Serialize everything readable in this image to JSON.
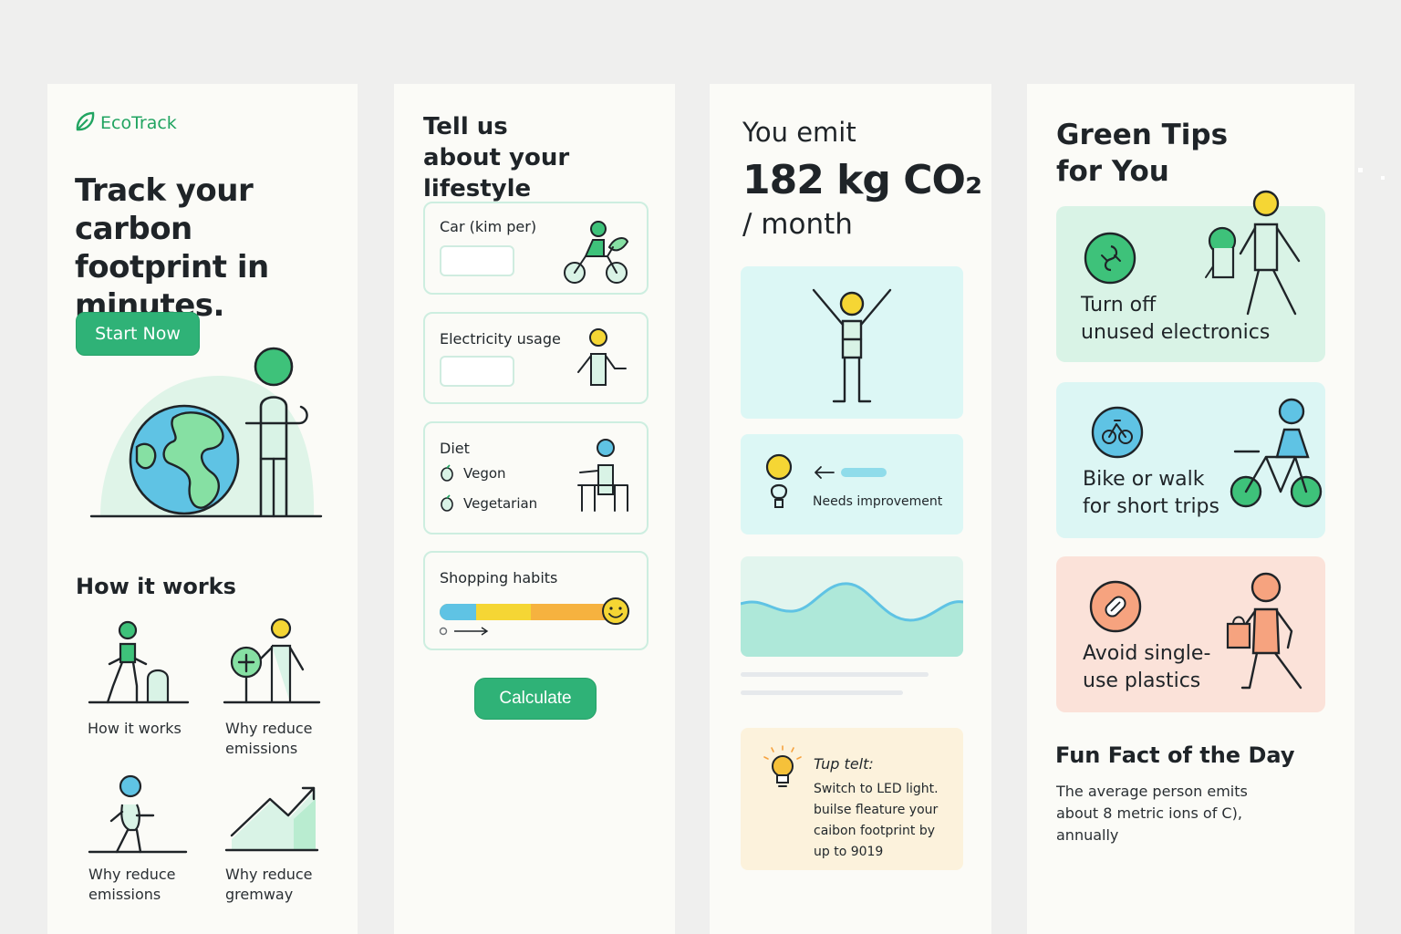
{
  "brand": {
    "name": "EcoTrack"
  },
  "landing": {
    "headline": "Track your carbon footprint in minutes.",
    "cta_label": "Start Now",
    "how_heading": "How it works",
    "steps": [
      {
        "label": "How it works"
      },
      {
        "label": "Why reduce emissions"
      },
      {
        "label": "Why reduce emissions"
      },
      {
        "label": "Why reduce gremway"
      }
    ]
  },
  "form": {
    "title_line1": "Tell us",
    "title_line2": "about your lifestyle",
    "car": {
      "label": "Car (kim per)",
      "value": ""
    },
    "electricity": {
      "label": "Electricity usage",
      "value": ""
    },
    "diet": {
      "label": "Diet",
      "options": [
        "Vegon",
        "Vegetarian"
      ]
    },
    "shopping": {
      "label": "Shopping habits"
    },
    "calculate_label": "Calculate"
  },
  "results": {
    "emit_label": "You emit",
    "emit_value": "182 kg CO₂",
    "emit_unit": "/ month",
    "status": "Needs improvement",
    "tip": {
      "title": "Tup telt:",
      "line1": "Switch to LED light.",
      "line2": "builse fleature your",
      "line3": "caibon footprint by",
      "line4": "up to 9019"
    }
  },
  "tips": {
    "title_line1": "Green Tips",
    "title_line2": "for You",
    "cards": [
      {
        "line1": "Turn off",
        "line2": "unused electronics",
        "icon": "plug-icon",
        "bg": "#d9f3e6"
      },
      {
        "line1": "Bike or walk",
        "line2": "for short trips",
        "icon": "bicycle-icon",
        "bg": "#dcf6f4"
      },
      {
        "line1": "Avoid single-",
        "line2": "use plastics",
        "icon": "pill-icon",
        "bg": "#fbe2d9"
      }
    ],
    "fun_heading": "Fun Fact of the Day",
    "fun_line1": "The average person emits",
    "fun_line2": "about 8 metric ions of C),",
    "fun_line3": "annually"
  },
  "colors": {
    "brand_green": "#2fb277",
    "mint": "#d9f3e6",
    "cyan": "#dcf6f4",
    "peach": "#fbe2d9",
    "cream": "#fcf2dc",
    "yellow": "#f5d634",
    "blue": "#5fc3e4",
    "orange": "#f6a37f"
  }
}
